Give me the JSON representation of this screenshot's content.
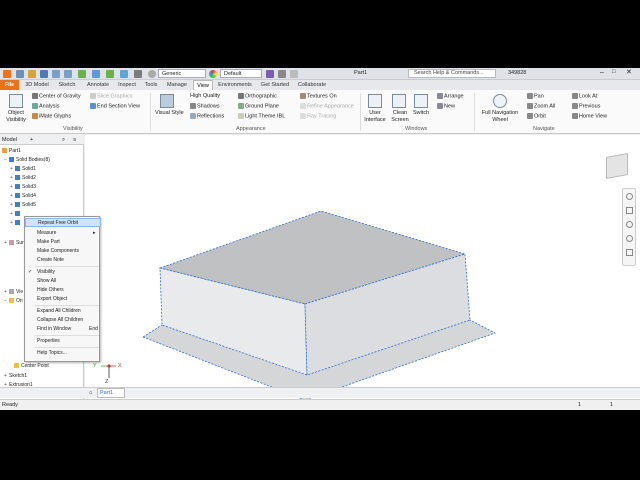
{
  "title": "Part1",
  "search_placeholder": "Search Help & Commands...",
  "user": "349828",
  "qat": {
    "material": "Generic",
    "appearance": "Default"
  },
  "tabs": [
    "File",
    "3D Model",
    "Sketch",
    "Annotate",
    "Inspect",
    "Tools",
    "Manage",
    "View",
    "Environments",
    "Get Started",
    "Collaborate"
  ],
  "active_tab": "View",
  "ribbon": {
    "visibility": {
      "object_visibility": "Object Visibility",
      "items": [
        "Center of Gravity",
        "Analysis",
        "iMate Glyphs"
      ],
      "dim_items": [
        "Slice Graphics"
      ],
      "end_section": "End Section View",
      "panel": "Visibility"
    },
    "appearance": {
      "visual_style": "Visual Style",
      "quality": "High Quality",
      "shadows": "Shadows",
      "reflections": "Reflections",
      "ortho": "Orthographic",
      "ground": "Ground Plane",
      "theme": "Light Theme IBL",
      "textures": "Textures On",
      "refine": "Refine Appearance",
      "ray": "Ray Tracing",
      "panel": "Appearance"
    },
    "windows": {
      "user_interface": "User Interface",
      "clean_screen": "Clean Screen",
      "switch": "Switch",
      "arrange": "Arrange",
      "new": "New",
      "panel": "Windows"
    },
    "navigate": {
      "full_nav": "Full Navigation Wheel",
      "pan": "Pan",
      "zoom_all": "Zoom All",
      "orbit": "Orbit",
      "look_at": "Look At",
      "previous": "Previous",
      "home_view": "Home View",
      "panel": "Navigate"
    }
  },
  "browser": {
    "header": "Model",
    "part": "Part1",
    "rows": [
      "Solid Bodies(8)",
      "Solid1",
      "Solid2",
      "Solid3",
      "Solid4",
      "Solid5"
    ],
    "partial": [
      "Sur",
      "Vie",
      "Ori"
    ],
    "bottom": [
      "Center Point",
      "Sketch1",
      "Extrusion1"
    ]
  },
  "context_menu": [
    "Repeat Free Orbit",
    "Measure",
    "Make Part",
    "Make Components",
    "Create Note",
    "Visibility",
    "Show All",
    "Hide Others",
    "Export Object",
    "Expand All Children",
    "Collapse All Children",
    "Find in Window",
    "Properties",
    "Help Topics..."
  ],
  "find_shortcut": "End",
  "doc_tab": "Part1",
  "status": {
    "left": "Ready",
    "n1": "1",
    "n2": "1"
  },
  "axes": {
    "x": "X",
    "y": "Y",
    "z": "Z"
  }
}
